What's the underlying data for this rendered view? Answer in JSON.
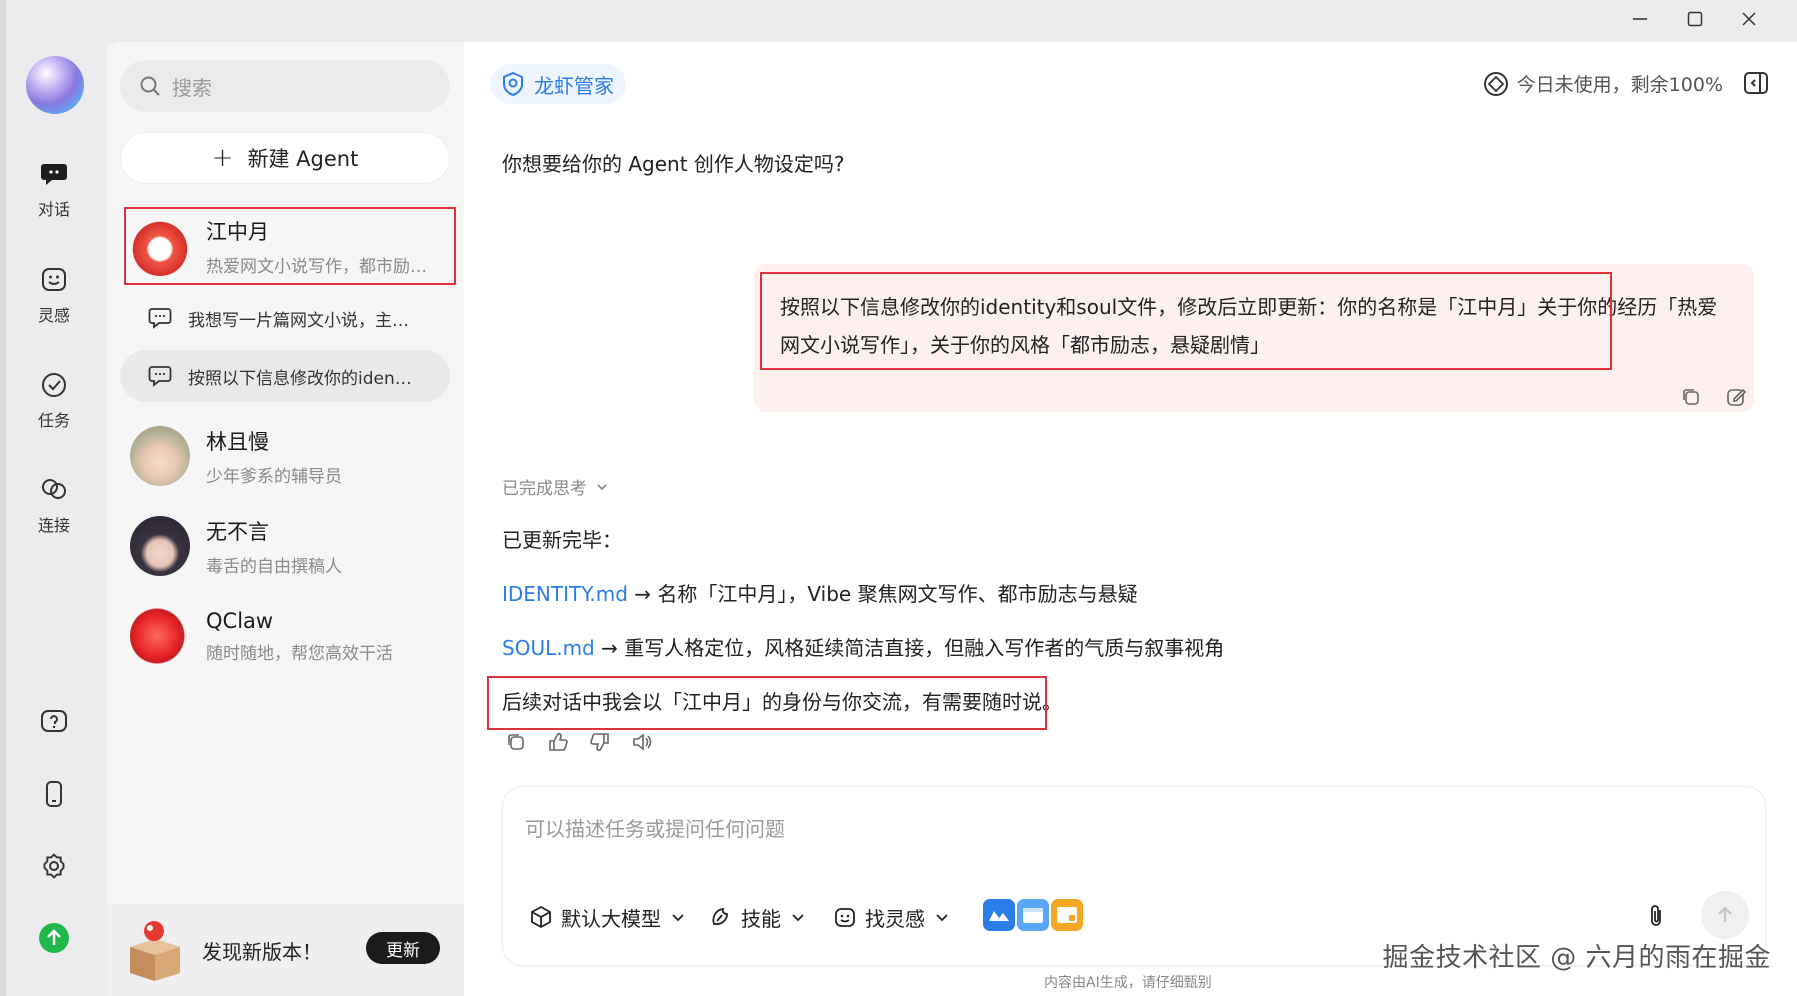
{
  "window": {
    "minimize": "—",
    "maximize": "▢",
    "close": "✕"
  },
  "rail": {
    "items": [
      {
        "label": "对话",
        "icon": "chat-icon"
      },
      {
        "label": "灵感",
        "icon": "inspiration-icon"
      },
      {
        "label": "任务",
        "icon": "task-icon"
      },
      {
        "label": "连接",
        "icon": "link-icon"
      }
    ],
    "bottom_icons": [
      "help-icon",
      "phone-icon",
      "settings-icon",
      "upgrade-icon"
    ]
  },
  "sidebar": {
    "search_placeholder": "搜索",
    "new_agent_label": "新建 Agent",
    "agents": [
      {
        "name": "江中月",
        "desc": "热爱网文小说写作，都市励…"
      },
      {
        "name": "林且慢",
        "desc": "少年爹系的辅导员"
      },
      {
        "name": "无不言",
        "desc": "毒舌的自由撰稿人"
      },
      {
        "name": "QClaw",
        "desc": "随时随地，帮您高效干活"
      }
    ],
    "sub_chats": [
      {
        "label": "我想写一片篇网文小说，主…"
      },
      {
        "label": "按照以下信息修改你的iden…"
      }
    ],
    "update": {
      "message": "发现新版本！",
      "button": "更新"
    }
  },
  "main": {
    "agent_tag": "龙虾管家",
    "usage": "今日未使用，剩余100%",
    "question": "你想要给你的 Agent 创作人物设定吗?",
    "user_message": "按照以下信息修改你的identity和soul文件，修改后立即更新：你的名称是「江中月」关于你的经历「热爱网文小说写作」，关于你的风格「都市励志，悬疑剧情」",
    "thinking_label": "已完成思考",
    "response": {
      "heading": "已更新完毕：",
      "line1_link": "IDENTITY.md",
      "line1_text": " → 名称「江中月」，Vibe 聚焦网文写作、都市励志与悬疑",
      "line2_link": "SOUL.md",
      "line2_text": " → 重写人格定位，风格延续简洁直接，但融入写作者的气质与叙事视角",
      "line3": "后续对话中我会以「江中月」的身份与你交流，有需要随时说。"
    },
    "composer": {
      "placeholder": "可以描述任务或提问任何问题",
      "tools": [
        {
          "label": "默认大模型",
          "icon": "model-cube-icon"
        },
        {
          "label": "技能",
          "icon": "skill-icon"
        },
        {
          "label": "找灵感",
          "icon": "inspiration-icon"
        }
      ]
    },
    "disclaimer": "内容由AI生成，请仔细甄别",
    "watermark": "掘金技术社区 @ 六月的雨在掘金"
  },
  "colors": {
    "accent": "#2b7de9",
    "highlight": "#e0303a",
    "user_bubble": "#fff0f0"
  }
}
